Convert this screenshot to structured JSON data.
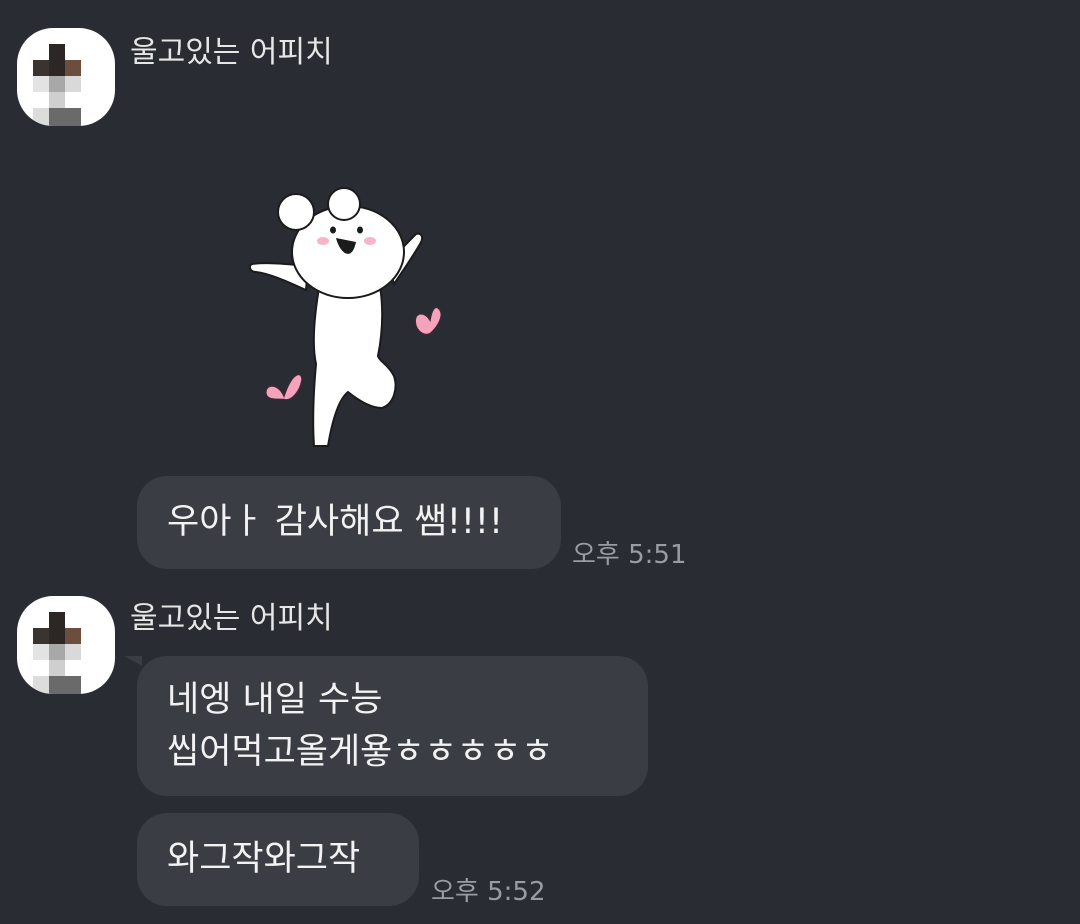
{
  "messages": [
    {
      "sender": "울고있는 어피치",
      "sticker": "white-bear-cheering-sticker",
      "text": "우아ㅏ 감사해요 쌤!!!!",
      "time": "오후 5:51"
    },
    {
      "sender": "울고있는 어피치",
      "text_line1": "네엥 내일 수능",
      "text_line2": "씹어먹고올게욯ㅎㅎㅎㅎㅎ",
      "text2": "와그작와그작",
      "time": "오후 5:52"
    }
  ],
  "colors": {
    "background": "#2a2c33",
    "bubble": "#3b3d44",
    "text": "#f2f2f2",
    "time": "#9a9ca3",
    "heart": "#f5a3bd"
  },
  "icons": {
    "avatar": "pixelated-profile-avatar",
    "sticker": "white-bear-cheering-sticker",
    "hearts": "pink-heart-icon"
  }
}
